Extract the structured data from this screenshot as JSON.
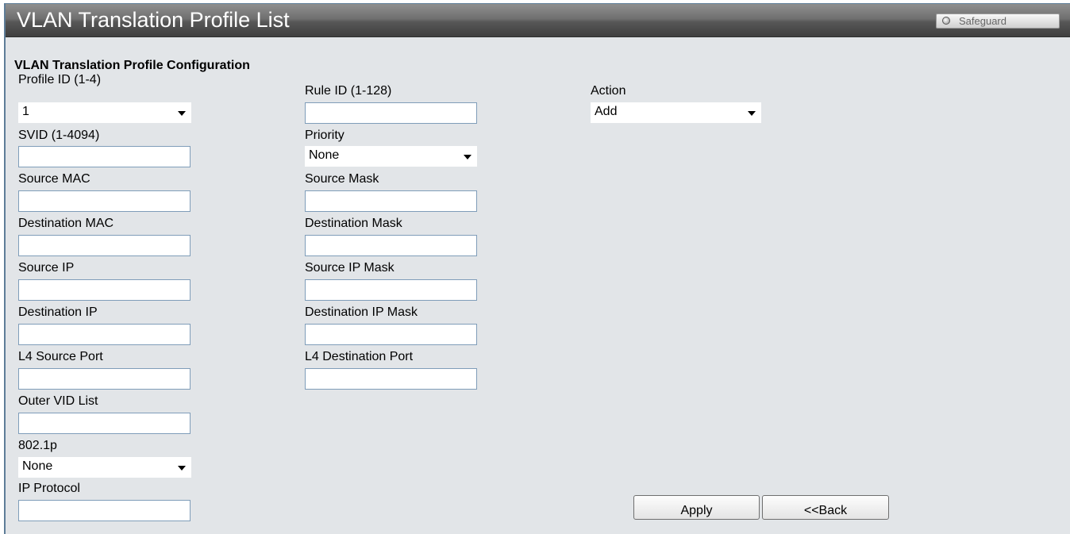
{
  "header": {
    "title": "VLAN Translation Profile List",
    "safeguard_label": "Safeguard"
  },
  "form": {
    "section_title": "VLAN Translation Profile Configuration",
    "profile_id": {
      "label": "Profile ID (1-4)",
      "value": "1"
    },
    "rule_id": {
      "label": "Rule ID (1-128)",
      "value": ""
    },
    "action": {
      "label": "Action",
      "value": "Add"
    },
    "svid": {
      "label": "SVID (1-4094)",
      "value": ""
    },
    "priority": {
      "label": "Priority",
      "value": "None"
    },
    "source_mac": {
      "label": "Source MAC",
      "value": ""
    },
    "source_mask": {
      "label": "Source Mask",
      "value": ""
    },
    "destination_mac": {
      "label": "Destination MAC",
      "value": ""
    },
    "destination_mask": {
      "label": "Destination Mask",
      "value": ""
    },
    "source_ip": {
      "label": "Source IP",
      "value": ""
    },
    "source_ip_mask": {
      "label": "Source IP Mask",
      "value": ""
    },
    "destination_ip": {
      "label": "Destination IP",
      "value": ""
    },
    "destination_ip_mask": {
      "label": "Destination IP Mask",
      "value": ""
    },
    "l4_source_port": {
      "label": "L4 Source Port",
      "value": ""
    },
    "l4_destination_port": {
      "label": "L4 Destination Port",
      "value": ""
    },
    "outer_vid_list": {
      "label": "Outer VID List",
      "value": ""
    },
    "dot1p": {
      "label": "802.1p",
      "value": "None"
    },
    "ip_protocol": {
      "label": "IP Protocol",
      "value": ""
    }
  },
  "buttons": {
    "apply": "Apply",
    "back": "<<Back"
  },
  "colors": {
    "title_bar": "#5a5a5a",
    "panel_bg": "#e2e5e8",
    "input_border": "#7f9db9"
  }
}
